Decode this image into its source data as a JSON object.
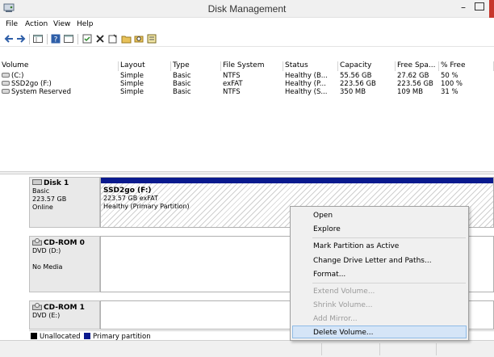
{
  "window": {
    "title": "Disk Management",
    "minimize_glyph": "–"
  },
  "menu": [
    "File",
    "Action",
    "View",
    "Help"
  ],
  "toolbar": {
    "icons": [
      "back-arrow-icon",
      "forward-arrow-icon",
      "volume-view-icon",
      "help-icon",
      "disk-view-icon",
      "properties-icon",
      "delete-icon",
      "properties-sheet-icon",
      "open-folder-icon",
      "search-icon",
      "rescan-icon"
    ]
  },
  "volume_table": {
    "columns": [
      "Volume",
      "Layout",
      "Type",
      "File System",
      "Status",
      "Capacity",
      "Free Spa...",
      "% Free"
    ],
    "rows": [
      [
        "(C:)",
        "Simple",
        "Basic",
        "NTFS",
        "Healthy (B...",
        "55.56 GB",
        "27.62 GB",
        "50 %"
      ],
      [
        "SSD2go (F:)",
        "Simple",
        "Basic",
        "exFAT",
        "Healthy (P...",
        "223.56 GB",
        "223.56 GB",
        "100 %"
      ],
      [
        "System Reserved",
        "Simple",
        "Basic",
        "NTFS",
        "Healthy (S...",
        "350 MB",
        "109 MB",
        "31 %"
      ]
    ]
  },
  "disks": [
    {
      "name": "Disk 1",
      "lines": [
        "Basic",
        "223.57 GB",
        "Online"
      ],
      "partition": {
        "name": "SSD2go (F:)",
        "size": "223.57 GB exFAT",
        "status": "Healthy (Primary Partition)"
      }
    },
    {
      "name": "CD-ROM 0",
      "lines": [
        "DVD (D:)",
        "",
        "No Media"
      ]
    },
    {
      "name": "CD-ROM 1",
      "lines": [
        "DVD (E:)"
      ]
    }
  ],
  "legend": [
    {
      "label": "Unallocated",
      "color": "#000000"
    },
    {
      "label": "Primary partition",
      "color": "#0a1a8e"
    }
  ],
  "context_menu": {
    "groups": [
      [
        {
          "label": "Open",
          "enabled": true
        },
        {
          "label": "Explore",
          "enabled": true
        }
      ],
      [
        {
          "label": "Mark Partition as Active",
          "enabled": true
        },
        {
          "label": "Change Drive Letter and Paths...",
          "enabled": true
        },
        {
          "label": "Format...",
          "enabled": true
        }
      ],
      [
        {
          "label": "Extend Volume...",
          "enabled": false
        },
        {
          "label": "Shrink Volume...",
          "enabled": false
        },
        {
          "label": "Add Mirror...",
          "enabled": false
        },
        {
          "label": "Delete Volume...",
          "enabled": true,
          "highlighted": true
        }
      ]
    ]
  },
  "colors": {
    "primary_partition": "#0a1a8e",
    "menu_highlight": "#d5e5f7",
    "close_button": "#c7372c"
  }
}
